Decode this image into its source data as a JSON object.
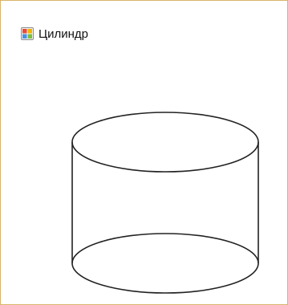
{
  "window": {
    "title": "Цилиндр",
    "icon": "windows-form-icon"
  },
  "colors": {
    "frame": "#d9b36a",
    "background": "#ffffff",
    "stroke": "#222222"
  },
  "drawing": {
    "shape": "cylinder"
  }
}
